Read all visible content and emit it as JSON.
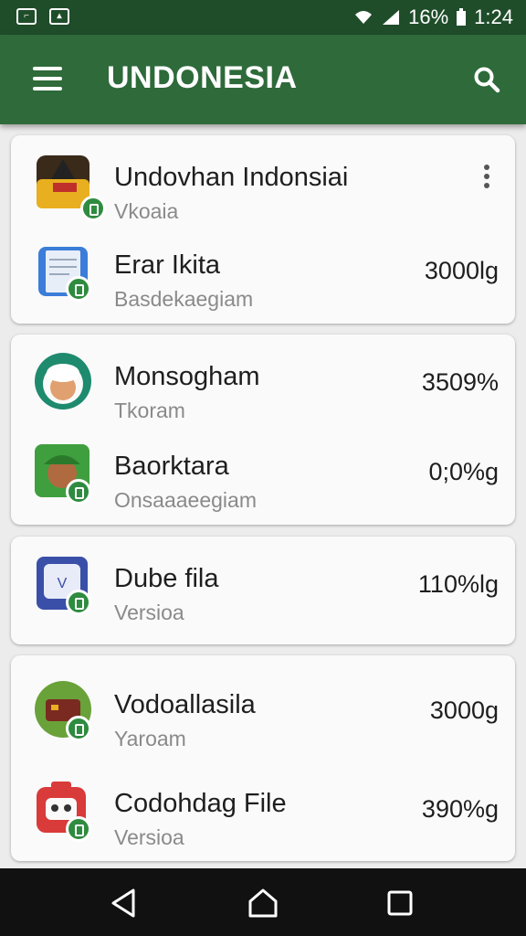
{
  "status_bar": {
    "notification_icons": [
      "cast-icon",
      "image-icon"
    ],
    "battery": "16%",
    "time": "1:24"
  },
  "app_bar": {
    "title": "UNDONESIA",
    "icons": [
      "menu-icon",
      "search-icon"
    ]
  },
  "cards": [
    {
      "rows": [
        {
          "name": "Undovhan Indonsiai",
          "subtitle": "Vkoaia",
          "value": "",
          "icon": "game-icon",
          "icon_color": "#c8a000"
        },
        {
          "name": "Erar Ikita",
          "subtitle": "Basdekaegiam",
          "value": "3000lg",
          "icon": "document-icon",
          "icon_color": "#3b7dd8"
        }
      ]
    },
    {
      "rows": [
        {
          "name": "Monsogham",
          "subtitle": "Tkoram",
          "value": "3509%",
          "icon": "avatar-icon",
          "icon_color": "#1e8a6e"
        },
        {
          "name": "Baorktara",
          "subtitle": "Onsaaaeegiam",
          "value": "0;0%g",
          "icon": "character-icon",
          "icon_color": "#3f9f3f"
        }
      ]
    },
    {
      "rows": [
        {
          "name": "Dube fila",
          "subtitle": "Versioa",
          "value": "110%lg",
          "icon": "file-icon",
          "icon_color": "#3a4fa8"
        }
      ]
    },
    {
      "rows": [
        {
          "name": "Vodoallasila",
          "subtitle": "Yaroam",
          "value": "3000g",
          "icon": "wallet-icon",
          "icon_color": "#6aa23a"
        },
        {
          "name": "Codohdag File",
          "subtitle": "Versioa",
          "value": "390%g",
          "icon": "robot-icon",
          "icon_color": "#d93a3a"
        }
      ]
    }
  ],
  "nav_bar": {
    "icons": [
      "back-icon",
      "home-icon",
      "recents-icon"
    ]
  }
}
